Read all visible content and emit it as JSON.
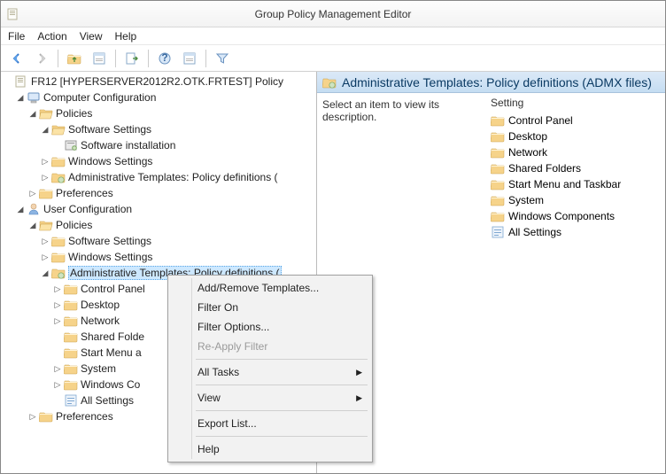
{
  "window": {
    "title": "Group Policy Management Editor"
  },
  "menu": {
    "file": "File",
    "action": "Action",
    "view": "View",
    "help": "Help"
  },
  "tree": {
    "root": "FR12 [HYPERSERVER2012R2.OTK.FRTEST] Policy",
    "cc": "Computer Configuration",
    "cc_policies": "Policies",
    "cc_ss": "Software Settings",
    "cc_si": "Software installation",
    "cc_ws": "Windows Settings",
    "cc_at": "Administrative Templates: Policy definitions (",
    "cc_pref": "Preferences",
    "uc": "User Configuration",
    "uc_policies": "Policies",
    "uc_ss": "Software Settings",
    "uc_ws": "Windows Settings",
    "uc_at": "Administrative Templates: Policy definitions (",
    "uc_cp": "Control Panel",
    "uc_dt": "Desktop",
    "uc_nw": "Network",
    "uc_sf": "Shared Folde",
    "uc_sm": "Start Menu a",
    "uc_sy": "System",
    "uc_wc": "Windows Co",
    "uc_as": "All Settings",
    "uc_pref": "Preferences"
  },
  "right": {
    "header": "Administrative Templates: Policy definitions (ADMX files)",
    "desc": "Select an item to view its description.",
    "col": "Setting",
    "items": {
      "cp": "Control Panel",
      "dt": "Desktop",
      "nw": "Network",
      "sf": "Shared Folders",
      "sm": "Start Menu and Taskbar",
      "sy": "System",
      "wc": "Windows Components",
      "as": "All Settings"
    }
  },
  "ctx": {
    "add_remove": "Add/Remove Templates...",
    "filter_on": "Filter On",
    "filter_options": "Filter Options...",
    "reapply": "Re-Apply Filter",
    "all_tasks": "All Tasks",
    "view": "View",
    "export": "Export List...",
    "help": "Help"
  }
}
